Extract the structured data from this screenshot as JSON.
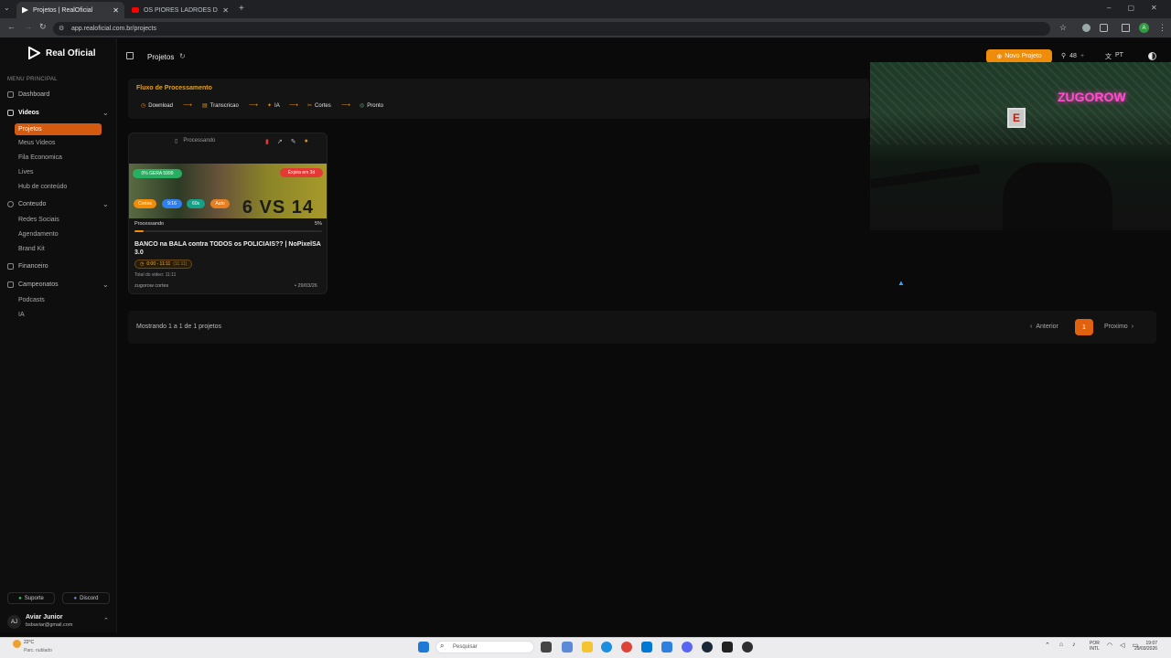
{
  "browser": {
    "tabs": [
      {
        "title": "Projetos | RealOficial"
      },
      {
        "title": "OS PIORES LADRÕES DE BANC"
      }
    ],
    "url": "app.realoficial.com.br/projects"
  },
  "sidebar": {
    "brand": "Real Oficial",
    "section_label": "MENU PRINCIPAL",
    "items": {
      "dashboard": "Dashboard",
      "videos": "Videos",
      "projetos": "Projetos",
      "meus_videos": "Meus Videos",
      "fila": "Fila Economica",
      "lives": "Lives",
      "hub": "Hub de conteúdo",
      "conteudo": "Conteudo",
      "redes": "Redes Sociais",
      "agendamento": "Agendamento",
      "brandkit": "Brand Kit",
      "financeiro": "Financeiro",
      "campeonatos": "Campeonatos",
      "podcasts": "Podcasts",
      "ia": "IA"
    },
    "support": "Suporte",
    "discord": "Discord",
    "user": {
      "initials": "AJ",
      "name": "Aviar Junior",
      "email": "bsbaviar@gmail.com"
    }
  },
  "header": {
    "title": "Projetos",
    "new_project": "Novo Projeto",
    "credits": "48",
    "lang": "PT"
  },
  "flow": {
    "title": "Fluxo de Processamento",
    "steps": [
      "Download",
      "Transcricao",
      "IA",
      "Cortes",
      "Pronto"
    ]
  },
  "card": {
    "status": "Processando",
    "badge_left": "0% GERA 5999",
    "badge_expire": "Expira em 3d",
    "tags": [
      "Cortes",
      "9:16",
      "60s",
      "Auto"
    ],
    "thumb_text": "6 VS 14",
    "progress_label": "Processando",
    "progress_value": "5%",
    "progress_fraction": 0.05,
    "title": "BANCO na BALA contra TODOS os POLICIAIS?? | NoPixelSA 3.0",
    "time_range": "0:00 - 11:11",
    "time_dur": "(11:11)",
    "total": "Total do video: 11:11",
    "channel": "zugorow cortes",
    "date": "• 29/03/26"
  },
  "webcam": {
    "sign": "ZUGOROW",
    "letter": "E"
  },
  "pager": {
    "summary": "Mostrando 1 a 1 de 1 projetos",
    "prev": "Anterior",
    "page": "1",
    "next": "Proximo"
  },
  "taskbar": {
    "weather_temp": "22°C",
    "weather_desc": "Parc. nublado",
    "search": "Pesquisar",
    "lang1": "POR",
    "lang2": "INTL",
    "time": "19:07",
    "date": "29/03/2026"
  },
  "colors": {
    "accent": "#ef8c09",
    "active": "#d35a0e",
    "flow_title": "#e3a116"
  }
}
